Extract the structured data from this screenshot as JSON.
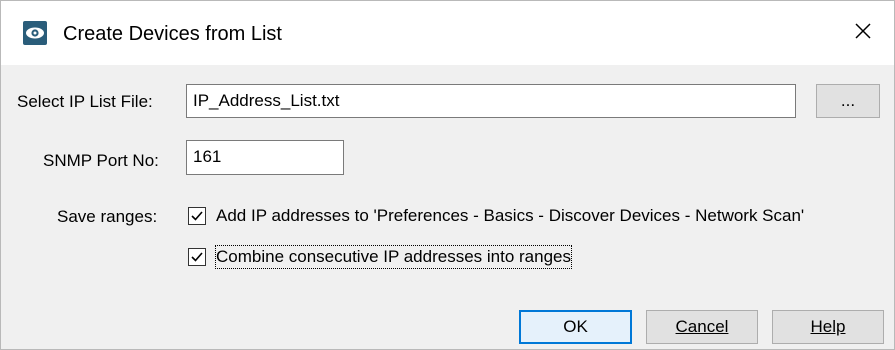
{
  "window": {
    "title": "Create Devices from List",
    "icon": "eye-app-icon",
    "close_icon": "close-icon"
  },
  "form": {
    "ip_list_label": "Select IP List File:",
    "ip_list_value": "IP_Address_List.txt",
    "browse_label": "...",
    "snmp_label": "SNMP Port No:",
    "snmp_value": "161",
    "save_ranges_label": "Save ranges:",
    "checkboxes": [
      {
        "label": "Add IP addresses to 'Preferences - Basics - Discover Devices - Network Scan'",
        "checked": true
      },
      {
        "label": "Combine consecutive IP addresses into ranges",
        "checked": true
      }
    ]
  },
  "buttons": {
    "ok": "OK",
    "cancel": "Cancel",
    "help": "Help"
  },
  "colors": {
    "accent": "#0078d7",
    "dialog_bg": "#f0f0f0",
    "icon_bg": "#2a5d7a"
  }
}
